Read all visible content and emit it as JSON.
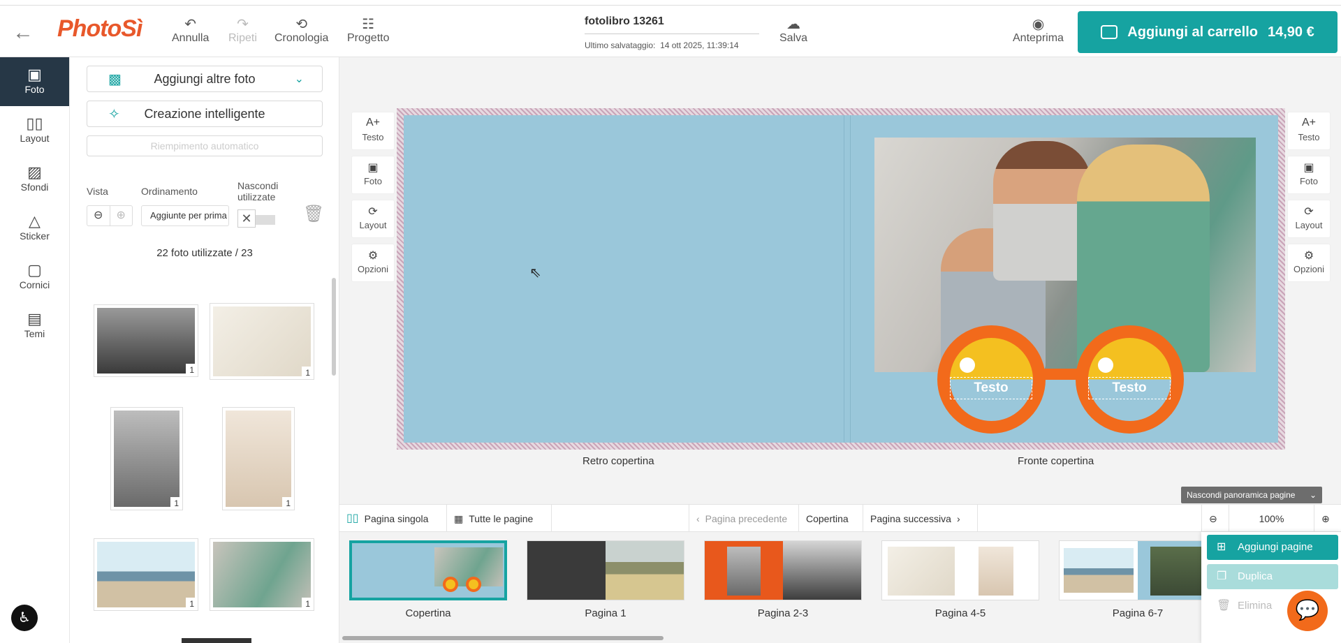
{
  "header": {
    "back_icon": "arrow-left-icon",
    "logo": "PhotoSì",
    "tools": [
      {
        "label": "Annulla",
        "icon": "undo-icon"
      },
      {
        "label": "Ripeti",
        "icon": "redo-icon"
      },
      {
        "label": "Cronologia",
        "icon": "history-icon"
      },
      {
        "label": "Progetto",
        "icon": "settings-sliders-icon"
      }
    ],
    "doc_title": "fotolibro 13261",
    "last_saved_label": "Ultimo salvataggio:",
    "last_saved_value": "14 ott 2025, 11:39:14",
    "save_label": "Salva",
    "preview_label": "Anteprima",
    "cart_label": "Aggiungi al carrello",
    "cart_price": "14,90 €",
    "accent": "#16a3a1"
  },
  "sidenav": {
    "items": [
      {
        "label": "Foto",
        "icon": "photos-icon"
      },
      {
        "label": "Layout",
        "icon": "layout-icon"
      },
      {
        "label": "Sfondi",
        "icon": "background-icon"
      },
      {
        "label": "Sticker",
        "icon": "sticker-icon"
      },
      {
        "label": "Cornici",
        "icon": "frame-icon"
      },
      {
        "label": "Temi",
        "icon": "theme-icon"
      }
    ]
  },
  "panel": {
    "add_photos": "Aggiungi altre foto",
    "smart_creation": "Creazione intelligente",
    "auto_fill": "Riempimento automatico",
    "view_label": "Vista",
    "sort_label": "Ordinamento",
    "sort_value": "Aggiunte per prima",
    "hide_used_label": "Nascondi utilizzate",
    "used_count": "22 foto utilizzate / 23",
    "photo_badges": [
      "1",
      "1",
      "1",
      "1",
      "1",
      "1"
    ]
  },
  "canvas": {
    "side_tools": [
      "Testo",
      "Foto",
      "Layout",
      "Opzioni"
    ],
    "back_cover_label": "Retro copertina",
    "front_cover_label": "Fronte copertina",
    "placeholder_text_1": "Testo",
    "placeholder_text_2": "Testo",
    "hide_overview": "Nascondi panoramica pagine"
  },
  "bottombar": {
    "single_page": "Pagina singola",
    "all_pages": "Tutte le pagine",
    "prev_page": "Pagina precedente",
    "current": "Copertina",
    "next_page": "Pagina successiva",
    "zoom": "100%"
  },
  "pages": [
    {
      "label": "Copertina"
    },
    {
      "label": "Pagina 1"
    },
    {
      "label": "Pagina 2-3"
    },
    {
      "label": "Pagina 4-5"
    },
    {
      "label": "Pagina 6-7"
    }
  ],
  "context_menu": {
    "add_pages": "Aggiungi pagine",
    "duplicate": "Duplica",
    "delete": "Elimina"
  }
}
